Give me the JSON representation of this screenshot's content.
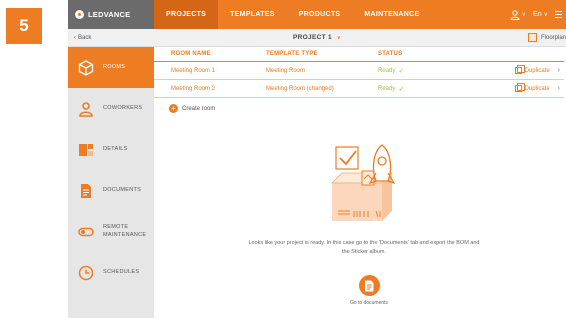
{
  "step_badge": "5",
  "header": {
    "brand": "LEDVANCE",
    "tabs": [
      {
        "label": "PROJECTS"
      },
      {
        "label": "TEMPLATES"
      },
      {
        "label": "PRODUCTS"
      },
      {
        "label": "MAINTENANCE"
      }
    ],
    "language": "En",
    "user_caret": "∨",
    "lang_caret": "∨",
    "active_color": "#d46615",
    "accent": "#ee7c22"
  },
  "subbar": {
    "back_label": "Back",
    "project_title": "PROJECT 1",
    "project_caret": "∨",
    "floorplan_label": "Floorplan"
  },
  "sidebar": {
    "items": [
      {
        "label": "ROOMS"
      },
      {
        "label": "COWORKERS"
      },
      {
        "label": "DETAILS"
      },
      {
        "label": "DOCUMENTS"
      },
      {
        "label": "REMOTE\nMAINTENANCE"
      },
      {
        "label": "SCHEDULES"
      }
    ]
  },
  "table": {
    "headers": [
      "ROOM NAME",
      "TEMPLATE TYPE",
      "STATUS"
    ],
    "rows": [
      {
        "room": "Meeting Room 1",
        "template": "Meeting Room",
        "status": "Ready",
        "action": "Duplicate"
      },
      {
        "room": "Meeting Room 2",
        "template": "Meeting Room (changed)",
        "status": "Ready",
        "action": "Duplicate"
      }
    ]
  },
  "create_room_label": "Create room",
  "empty_state": {
    "message": "Looks like your project is ready. In this case go to the 'Documents' tab and export the BOM and the Sticker album.",
    "button_label": "Go to documents"
  }
}
